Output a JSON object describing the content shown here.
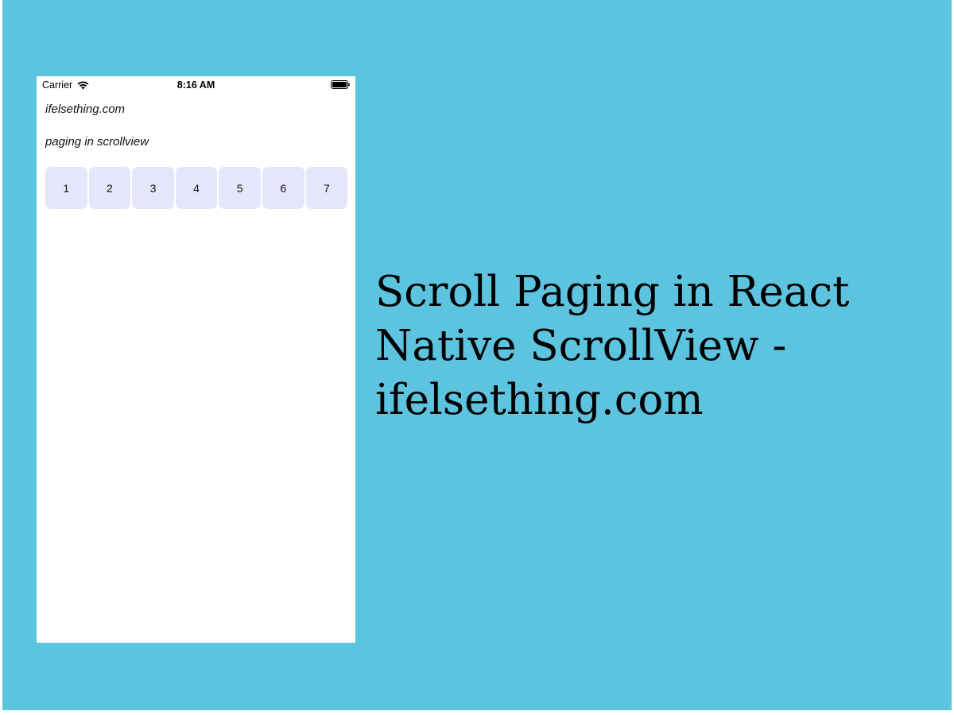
{
  "status_bar": {
    "carrier": "Carrier",
    "time": "8:16 AM",
    "wifi_icon": "wifi-icon",
    "battery_icon": "battery-icon"
  },
  "app": {
    "site_label": "ifelsething.com",
    "paging_label": "paging in scrollview",
    "pages": [
      "1",
      "2",
      "3",
      "4",
      "5",
      "6",
      "7"
    ],
    "page_color": "#e6e6fa"
  },
  "headline": {
    "lines": [
      "Scroll Paging in React",
      "Native ScrollView -",
      "ifelsething.com"
    ]
  },
  "colors": {
    "background": "#5dc4e0",
    "phone_background": "#ffffff"
  }
}
